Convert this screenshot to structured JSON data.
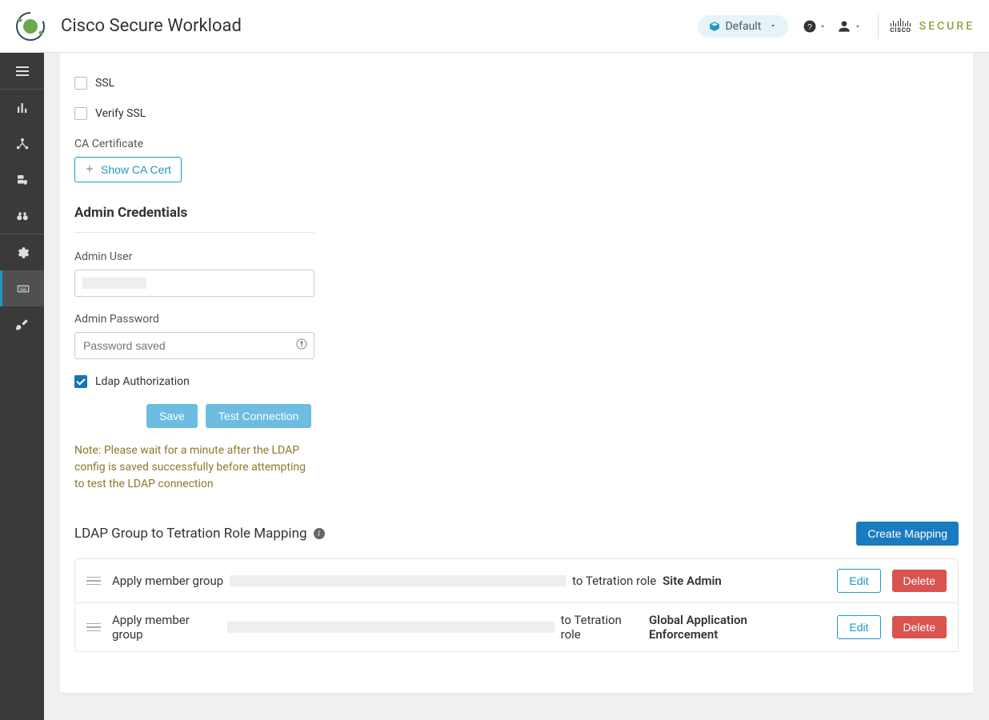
{
  "header": {
    "title": "Cisco Secure Workload",
    "tenant_label": "Default",
    "secure_label": "SECURE",
    "cisco_label": "cisco"
  },
  "form": {
    "ssl_label": "SSL",
    "verify_ssl_label": "Verify SSL",
    "ca_cert_label": "CA Certificate",
    "show_ca_cert_label": "Show CA Cert",
    "admin_credentials_title": "Admin Credentials",
    "admin_user_label": "Admin User",
    "admin_user_value": "",
    "admin_password_label": "Admin Password",
    "admin_password_placeholder": "Password saved",
    "ldap_auth_label": "Ldap Authorization",
    "ldap_auth_checked": true,
    "save_label": "Save",
    "test_connection_label": "Test Connection",
    "note_text": "Note: Please wait for a minute after the LDAP config is saved successfully before attempting to test the LDAP connection"
  },
  "mapping": {
    "section_title": "LDAP Group to Tetration Role Mapping",
    "create_label": "Create Mapping",
    "prefix": "Apply member group",
    "mid": "to Tetration role",
    "rows": [
      {
        "role": "Site Admin"
      },
      {
        "role": "Global Application Enforcement"
      }
    ],
    "edit_label": "Edit",
    "delete_label": "Delete"
  }
}
